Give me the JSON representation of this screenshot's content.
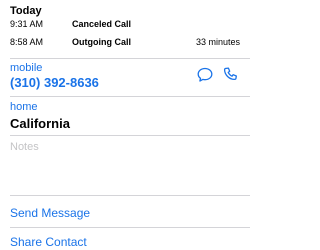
{
  "history": {
    "title": "Today",
    "calls": [
      {
        "time": "9:31 AM",
        "type": "Canceled Call",
        "duration": ""
      },
      {
        "time": "8:58 AM",
        "type": "Outgoing Call",
        "duration": "33 minutes"
      }
    ]
  },
  "phone": {
    "label": "mobile",
    "number": "(310) 392-8636",
    "message_icon": "speech-bubble-icon",
    "call_icon": "phone-handset-icon"
  },
  "address": {
    "label": "home",
    "value": "California"
  },
  "notes": {
    "placeholder": "Notes",
    "value": ""
  },
  "actions": {
    "send_message": "Send Message",
    "share_contact": "Share Contact"
  },
  "colors": {
    "accent": "#1a73e8",
    "divider": "#d4d4d8",
    "placeholder": "#c4c4c6"
  }
}
